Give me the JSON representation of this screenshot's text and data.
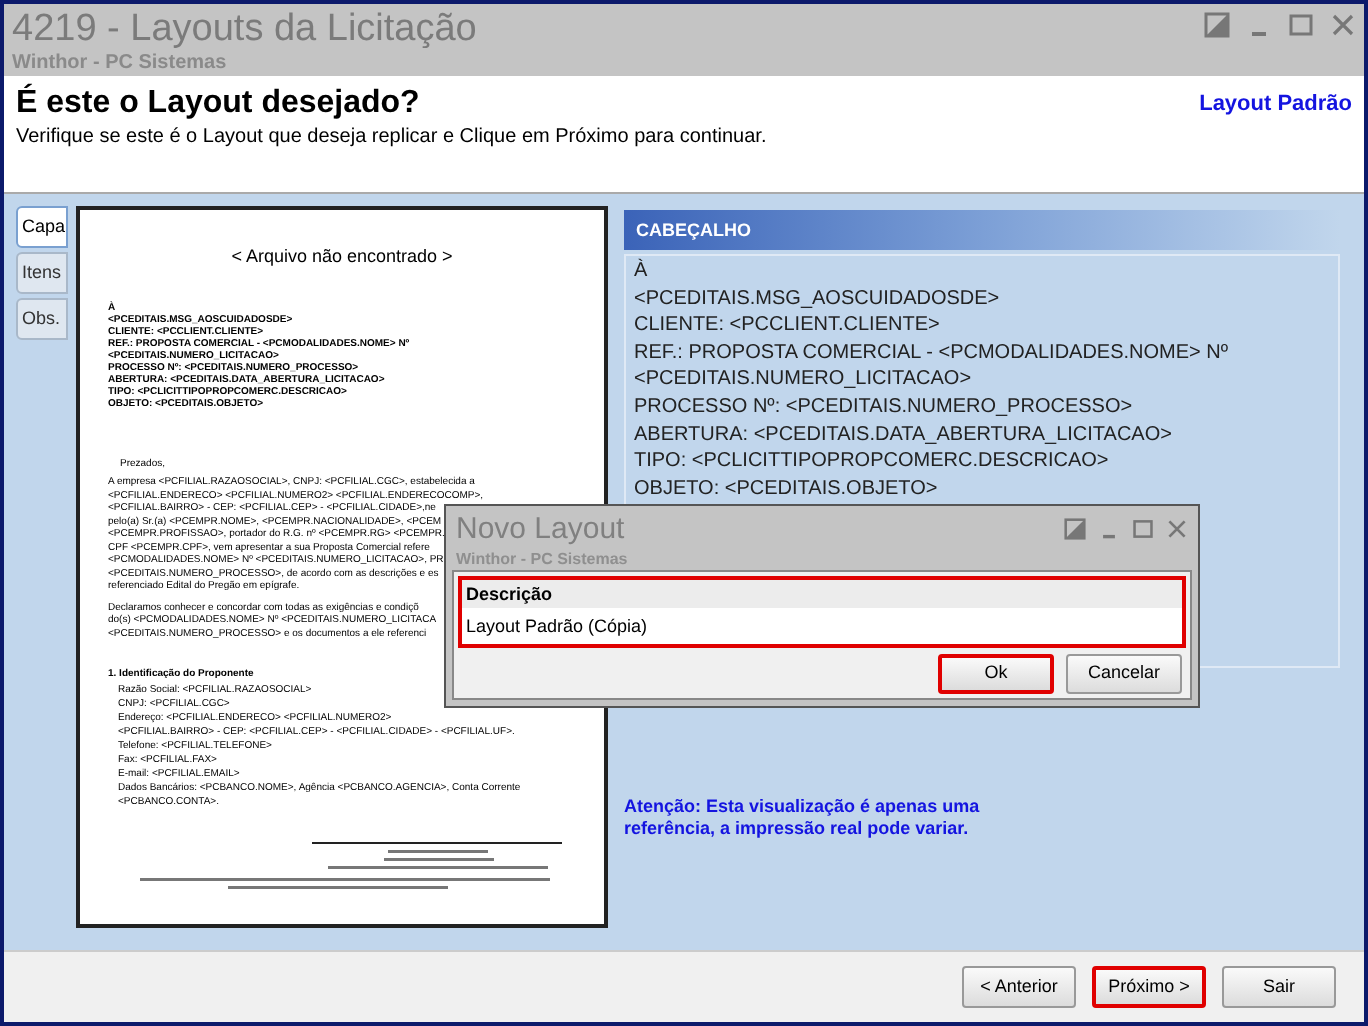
{
  "window": {
    "title": "4219 - Layouts da Licitação",
    "subtitle": "Winthor - PC Sistemas"
  },
  "header": {
    "title": "É este o Layout desejado?",
    "instruction": "Verifique se este é o Layout que deseja replicar e Clique em Próximo para continuar.",
    "layout_name": "Layout Padrão"
  },
  "tabs": [
    {
      "label": "Capa",
      "selected": true
    },
    {
      "label": "Itens",
      "selected": false
    },
    {
      "label": "Obs.",
      "selected": false
    }
  ],
  "preview": {
    "notice": "< Arquivo não encontrado >",
    "address_lines": [
      "À",
      "<PCEDITAIS.MSG_AOSCUIDADOSDE>",
      "CLIENTE: <PCCLIENT.CLIENTE>",
      "REF.: PROPOSTA COMERCIAL - <PCMODALIDADES.NOME> Nº",
      "<PCEDITAIS.NUMERO_LICITACAO>",
      "PROCESSO Nº: <PCEDITAIS.NUMERO_PROCESSO>",
      "ABERTURA: <PCEDITAIS.DATA_ABERTURA_LICITACAO>",
      "TIPO: <PCLICITTIPOPROPCOMERC.DESCRICAO>",
      "OBJETO: <PCEDITAIS.OBJETO>"
    ],
    "greeting": "Prezados,",
    "paragraph_1": [
      "A empresa <PCFILIAL.RAZAOSOCIAL>, CNPJ: <PCFILIAL.CGC>, estabelecida a",
      "<PCFILIAL.ENDERECO> <PCFILIAL.NUMERO2> <PCFILIAL.ENDERECOCOMP>,",
      "<PCFILIAL.BAIRRO> - CEP: <PCFILIAL.CEP> - <PCFILIAL.CIDADE>,ne",
      "pelo(a) Sr.(a) <PCEMPR.NOME>, <PCEMPR.NACIONALIDADE>, <PCEM",
      "<PCEMPR.PROFISSAO>, portador do R.G. nº <PCEMPR.RG> <PCEMPR.",
      "CPF <PCEMPR.CPF>, vem apresentar a sua Proposta Comercial refere",
      "<PCMODALIDADES.NOME> Nº <PCEDITAIS.NUMERO_LICITACAO>, PR",
      "<PCEDITAIS.NUMERO_PROCESSO>, de acordo com as descrições e es",
      "referenciado Edital do Pregão em epígrafe."
    ],
    "paragraph_2": [
      "Declaramos conhecer e concordar com todas as exigências e condiçõ",
      "do(s) <PCMODALIDADES.NOME> Nº <PCEDITAIS.NUMERO_LICITACA",
      "<PCEDITAIS.NUMERO_PROCESSO> e os documentos a ele referenci"
    ],
    "section_title": "1. Identificação do Proponente",
    "section_lines": [
      "Razão Social: <PCFILIAL.RAZAOSOCIAL>",
      "CNPJ: <PCFILIAL.CGC>",
      "Endereço: <PCFILIAL.ENDERECO> <PCFILIAL.NUMERO2>",
      "<PCFILIAL.BAIRRO> - CEP: <PCFILIAL.CEP> - <PCFILIAL.CIDADE> - <PCFILIAL.UF>.",
      "Telefone: <PCFILIAL.TELEFONE>",
      "Fax: <PCFILIAL.FAX>",
      "E-mail: <PCFILIAL.EMAIL>",
      "Dados Bancários: <PCBANCO.NOME>, Agência <PCBANCO.AGENCIA>, Conta Corrente",
      "<PCBANCO.CONTA>."
    ]
  },
  "section": {
    "title": "CABEÇALHO",
    "lines": [
      "À",
      "<PCEDITAIS.MSG_AOSCUIDADOSDE>",
      "CLIENTE: <PCCLIENT.CLIENTE>",
      "REF.: PROPOSTA COMERCIAL - <PCMODALIDADES.NOME> Nº",
      "<PCEDITAIS.NUMERO_LICITACAO>",
      "PROCESSO Nº: <PCEDITAIS.NUMERO_PROCESSO>",
      "ABERTURA: <PCEDITAIS.DATA_ABERTURA_LICITACAO>",
      "TIPO: <PCLICITTIPOPROPCOMERC.DESCRICAO>",
      "OBJETO: <PCEDITAIS.OBJETO>"
    ]
  },
  "warning": [
    "Atenção: Esta visualização é apenas uma",
    "referência, a impressão real pode variar."
  ],
  "dialog": {
    "title": "Novo Layout",
    "subtitle": "Winthor - PC Sistemas",
    "field_label": "Descrição",
    "field_value": "Layout Padrão (Cópia)",
    "field_highlighted": true,
    "buttons": [
      {
        "label": "Ok",
        "highlighted": true
      },
      {
        "label": "Cancelar",
        "highlighted": false
      }
    ]
  },
  "buttons": [
    {
      "label": "< Anterior",
      "highlighted": false
    },
    {
      "label": "Próximo >",
      "highlighted": true
    },
    {
      "label": "Sair",
      "highlighted": false
    }
  ]
}
